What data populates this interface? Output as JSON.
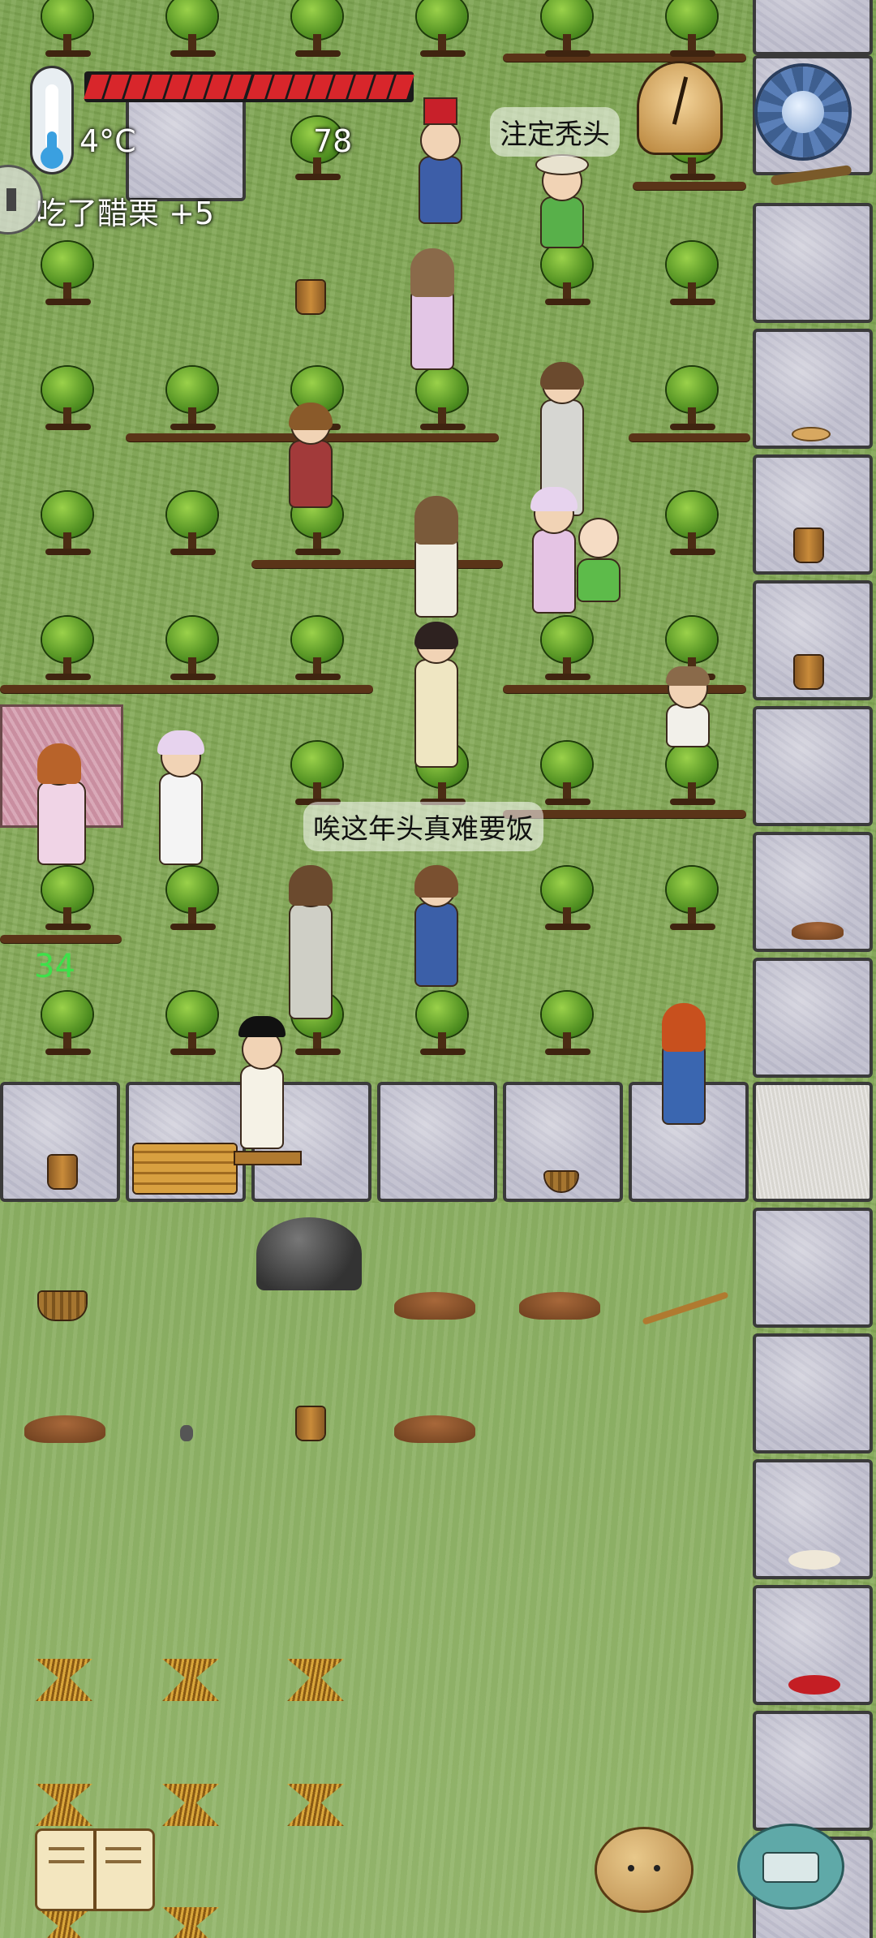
{
  "hud": {
    "temperature": "4°C",
    "food_count": "78",
    "status_message": "吃了醋栗 +5",
    "food_bar_segments": 16,
    "age_readout": "34",
    "colors": {
      "food_bar": "#d8262b",
      "thermometer": "#3aa0e0",
      "age_text": "#3ee04a"
    }
  },
  "speech": {
    "bubble_1": "注定秃头",
    "bubble_2": "唉这年头真难要饭"
  },
  "icons": {
    "settings": "gear-icon",
    "clock": "clock-icon",
    "recipe_book": "book-icon",
    "emote": "potato-emote-icon",
    "keyboard": "keyboard-icon",
    "thermometer": "thermometer-icon",
    "speaker": "speaker-icon"
  }
}
